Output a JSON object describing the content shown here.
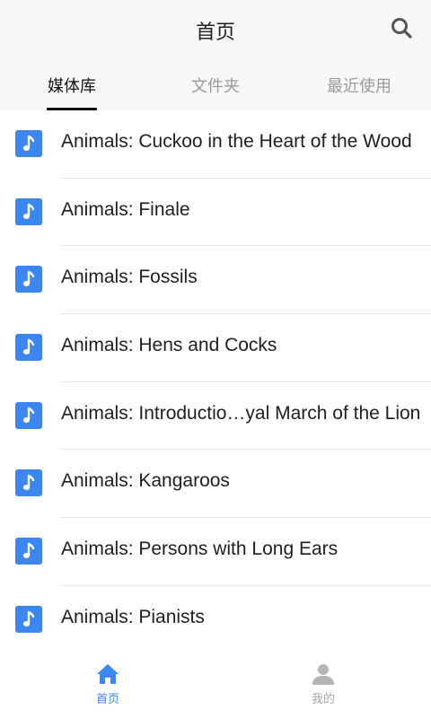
{
  "header": {
    "title": "首页",
    "search_icon": "search-icon"
  },
  "tabs": [
    {
      "label": "媒体库",
      "active": true
    },
    {
      "label": "文件夹",
      "active": false
    },
    {
      "label": "最近使用",
      "active": false
    }
  ],
  "list": {
    "item_icon": "music-note-icon",
    "items": [
      {
        "title": "Animals: Cuckoo in the Heart of the Wood"
      },
      {
        "title": "Animals: Finale"
      },
      {
        "title": "Animals: Fossils"
      },
      {
        "title": "Animals: Hens and Cocks"
      },
      {
        "title": "Animals: Introductio…yal March of the Lion"
      },
      {
        "title": "Animals: Kangaroos"
      },
      {
        "title": "Animals: Persons with Long Ears"
      },
      {
        "title": "Animals: Pianists"
      }
    ]
  },
  "bottom_nav": {
    "items": [
      {
        "label": "首页",
        "icon": "home-icon",
        "active": true
      },
      {
        "label": "我的",
        "icon": "user-icon",
        "active": false
      }
    ]
  },
  "colors": {
    "accent": "#3b86f0",
    "header_bg": "#f7f7f7",
    "inactive": "#b5b5b5"
  }
}
